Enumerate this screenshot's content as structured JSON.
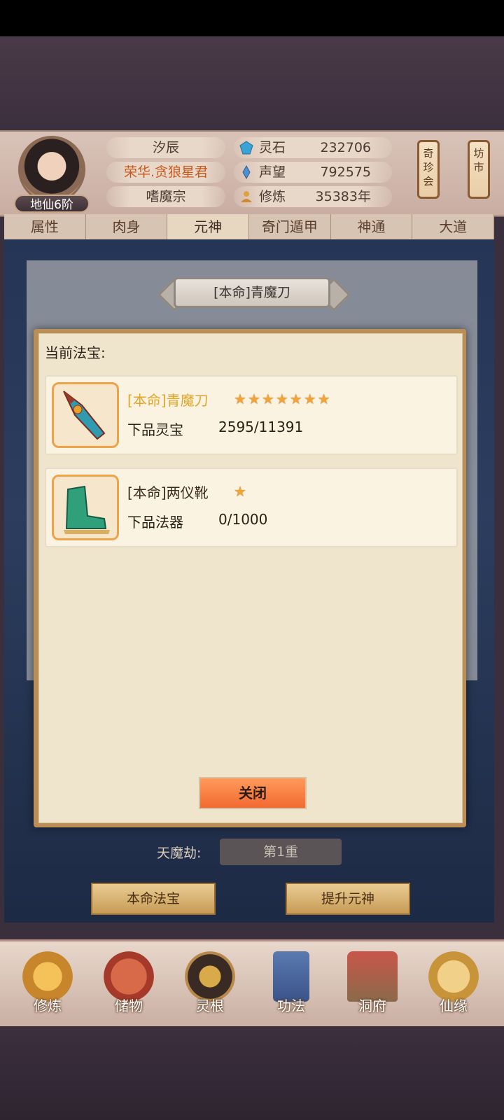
{
  "header": {
    "player_name": "汐辰",
    "title": "荣华.贪狼星君",
    "sect": "嗜魔宗",
    "rank": "地仙6阶",
    "resources": [
      {
        "label": "灵石",
        "value": "232706",
        "icon": "spirit-stone-icon"
      },
      {
        "label": "声望",
        "value": "792575",
        "icon": "prestige-icon"
      },
      {
        "label": "修炼",
        "value": "35383年",
        "icon": "cultivation-icon"
      }
    ],
    "lanterns": [
      {
        "label": "奇\n珍\n会"
      },
      {
        "label": "坊\n市"
      }
    ]
  },
  "tabs": [
    {
      "label": "属性"
    },
    {
      "label": "肉身"
    },
    {
      "label": "元神"
    },
    {
      "label": "奇门遁甲"
    },
    {
      "label": "神通"
    },
    {
      "label": "大道"
    }
  ],
  "scene": {
    "banner_title": "[本命]青魔刀",
    "tianmojie_label": "天魔劫:",
    "tianmojie_value": "第1重",
    "benming_button": "本命法宝",
    "upgrade_button": "提升元神"
  },
  "dialog": {
    "heading": "当前法宝:",
    "items": [
      {
        "name": "[本命]青魔刀",
        "name_color": "#e0a62a",
        "stars": 7,
        "grade": "下品灵宝",
        "progress": "2595/11391"
      },
      {
        "name": "[本命]两仪靴",
        "name_color": "#3a2a1c",
        "stars": 1,
        "grade": "下品法器",
        "progress": "0/1000"
      }
    ],
    "close_label": "关闭"
  },
  "bottom_nav": [
    {
      "label": "修炼",
      "icon": "cultivate-icon"
    },
    {
      "label": "储物",
      "icon": "storage-bag-icon"
    },
    {
      "label": "灵根",
      "icon": "spirit-root-icon"
    },
    {
      "label": "功法",
      "icon": "technique-book-icon"
    },
    {
      "label": "洞府",
      "icon": "cave-dwelling-icon"
    },
    {
      "label": "仙缘",
      "icon": "immortal-fate-icon"
    }
  ],
  "colors": {
    "accent_orange": "#f26a32",
    "item_frame": "#eea24a",
    "star": "#f2a43a"
  }
}
